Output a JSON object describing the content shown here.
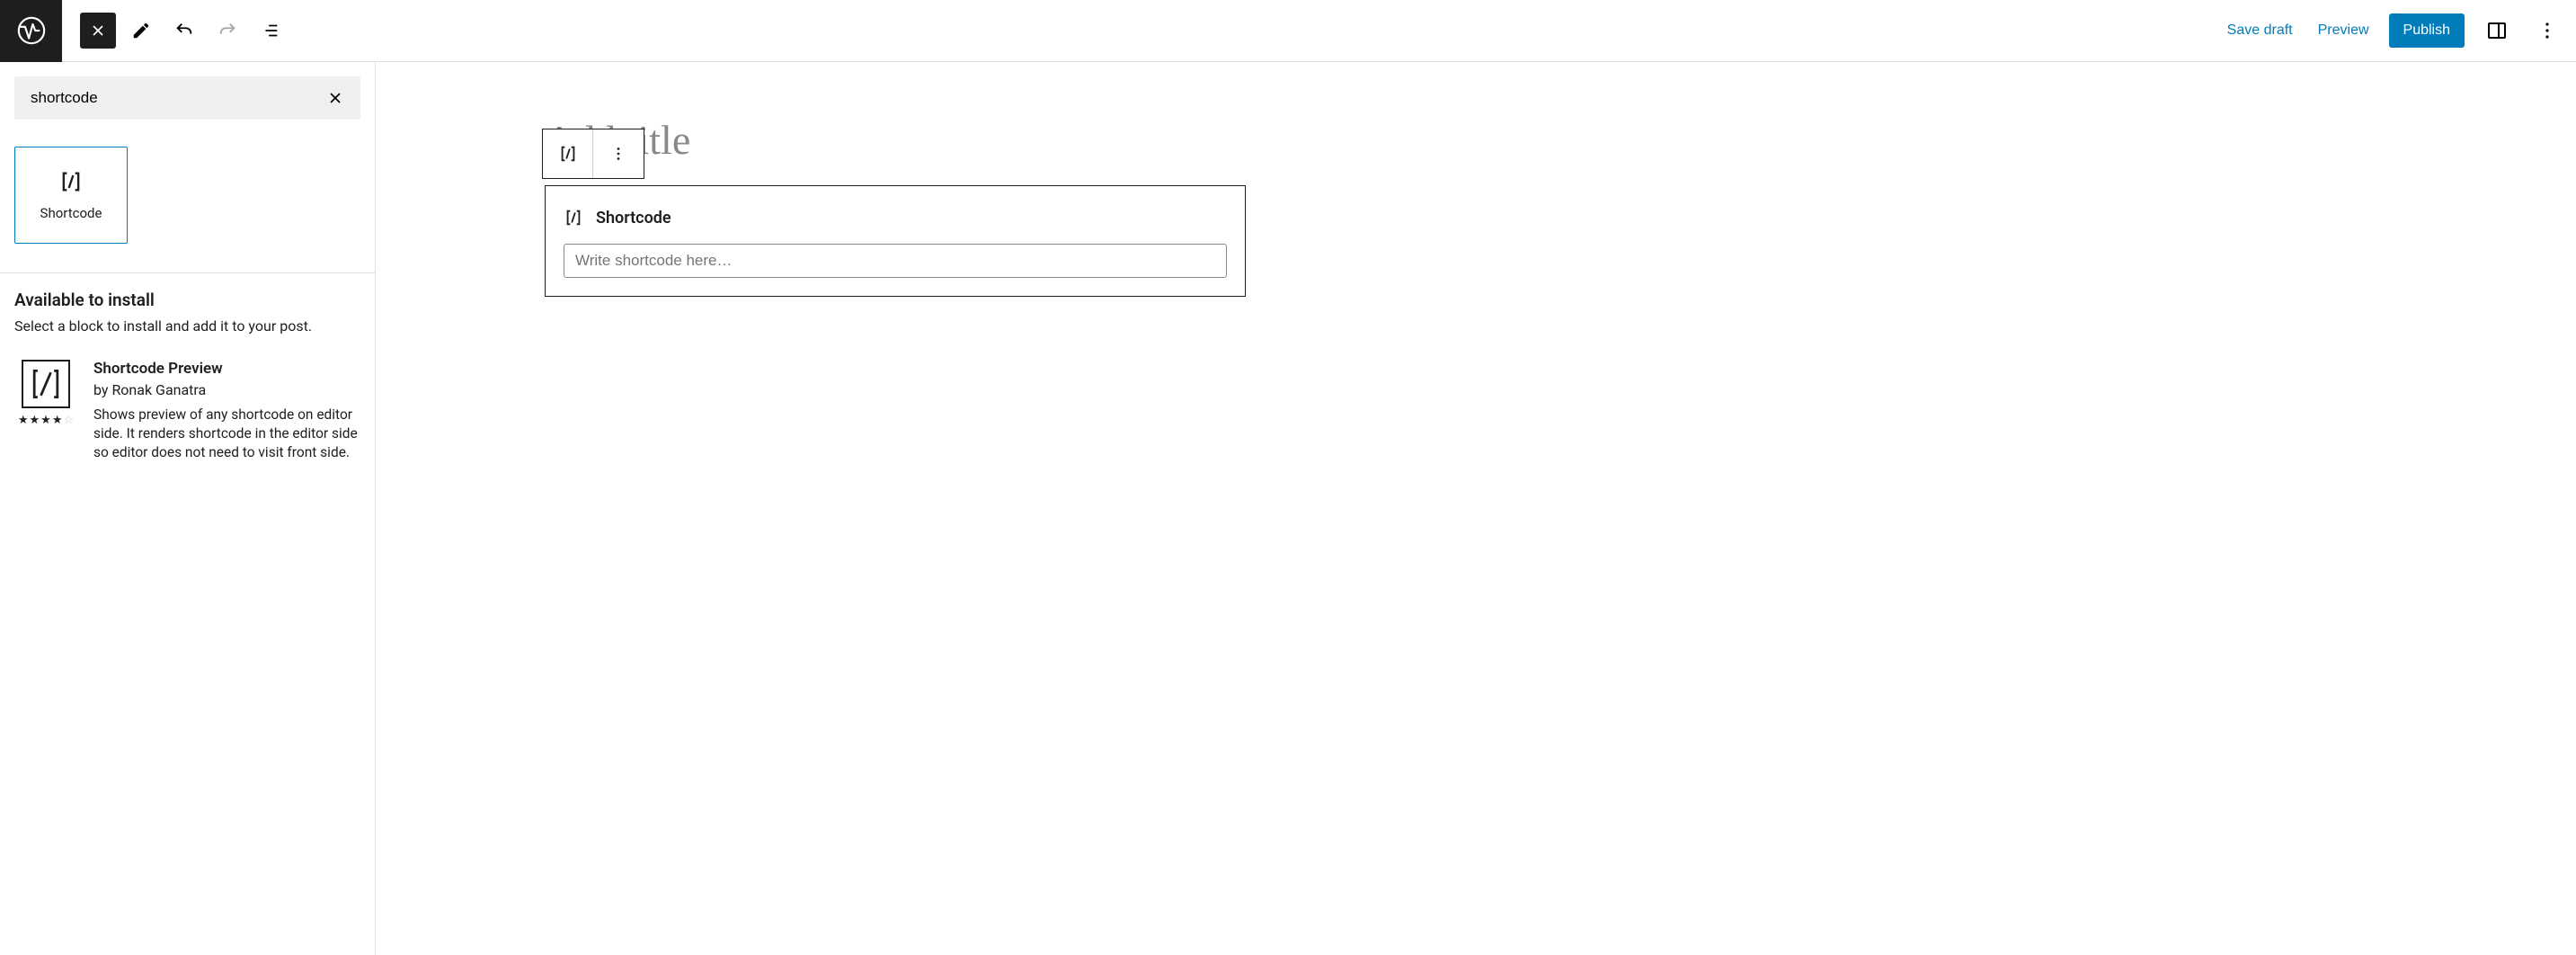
{
  "topbar": {
    "save_draft": "Save draft",
    "preview": "Preview",
    "publish": "Publish"
  },
  "sidebar": {
    "search_value": "shortcode",
    "block": {
      "label": "Shortcode"
    },
    "available": {
      "title": "Available to install",
      "description": "Select a block to install and add it to your post."
    },
    "install_item": {
      "name": "Shortcode Preview",
      "author": "by Ronak Ganatra",
      "description": "Shows preview of any shortcode on editor side. It renders shortcode in the editor side so editor does not need to visit front side.",
      "rating_filled": 4,
      "rating_total": 5
    }
  },
  "content": {
    "title_placeholder": "Add title",
    "block": {
      "label": "Shortcode",
      "input_placeholder": "Write shortcode here…"
    }
  }
}
